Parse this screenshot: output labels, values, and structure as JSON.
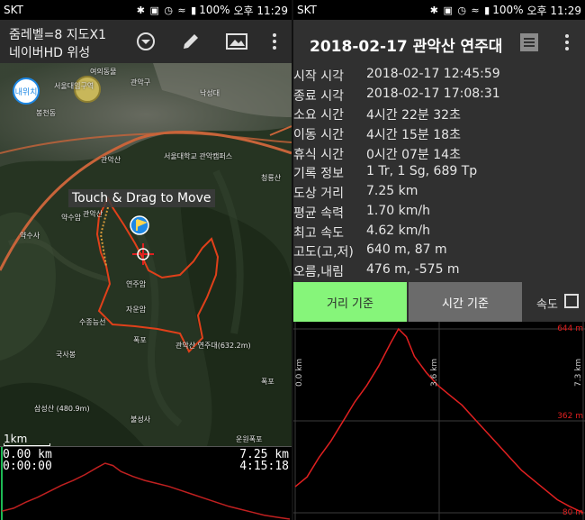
{
  "status_left": {
    "carrier": "SKT",
    "battery": "100%",
    "time": "오후 11:29"
  },
  "status_right": {
    "carrier": "SKT",
    "battery": "100%",
    "time": "오후 11:29"
  },
  "map_toolbar": {
    "zoom_line": "줌레벨=8 지도X1",
    "layer_line": "네이버HD 위성"
  },
  "map": {
    "locate_button": "내위치",
    "touch_hint": "Touch & Drag to Move",
    "scale": "1km",
    "labels": [
      {
        "text": "여의동물"
      },
      {
        "text": "서울대입구역"
      },
      {
        "text": "관악구"
      },
      {
        "text": "낙성대"
      },
      {
        "text": "봉천동"
      },
      {
        "text": "관악산"
      },
      {
        "text": "서울대학교 관악캠퍼스"
      },
      {
        "text": "청룡산"
      },
      {
        "text": "약수암"
      },
      {
        "text": "관악산"
      },
      {
        "text": "약수사"
      },
      {
        "text": "연주암"
      },
      {
        "text": "자운암"
      },
      {
        "text": "수종능선"
      },
      {
        "text": "폭포"
      },
      {
        "text": "관악산 연주대(632.2m)"
      },
      {
        "text": "국사봉"
      },
      {
        "text": "삼성산 (480.9m)"
      },
      {
        "text": "폭포"
      },
      {
        "text": "불성사"
      },
      {
        "text": "운원폭포"
      }
    ]
  },
  "left_profile": {
    "start_dist": "0.00 km",
    "start_time": "0:00:00",
    "end_dist": "7.25 km",
    "end_time": "4:15:18"
  },
  "track_title": "2018-02-17 관악산 연주대",
  "stats": [
    {
      "key": "시작 시각",
      "value": "2018-02-17 12:45:59"
    },
    {
      "key": "종료 시각",
      "value": "2018-02-17 17:08:31"
    },
    {
      "key": "소요 시간",
      "value": "4시간 22분 32초"
    },
    {
      "key": "이동 시간",
      "value": "4시간 15분 18초"
    },
    {
      "key": "휴식 시간",
      "value": "0시간 07분 14초"
    },
    {
      "key": "기록 정보",
      "value": "1 Tr, 1 Sg, 689 Tp"
    },
    {
      "key": "도상 거리",
      "value": "7.25 km"
    },
    {
      "key": "평균 속력",
      "value": "1.70 km/h"
    },
    {
      "key": "최고 속도",
      "value": "4.62 km/h"
    },
    {
      "key": "고도(고,저)",
      "value": "640 m, 87 m"
    },
    {
      "key": "오름,내림",
      "value": "476 m, -575 m"
    }
  ],
  "buttons": {
    "by_distance": "거리 기준",
    "by_time": "시간 기준",
    "speed_label": "속도"
  },
  "chart_data": {
    "type": "line",
    "x_ticks": [
      "0.0 km",
      "3.6 km",
      "7.3 km"
    ],
    "y_ticks": [
      "644 m",
      "362 m",
      "80 m"
    ],
    "x": [
      0.0,
      0.3,
      0.6,
      0.9,
      1.2,
      1.5,
      1.8,
      2.1,
      2.4,
      2.6,
      2.8,
      3.0,
      3.3,
      3.6,
      3.9,
      4.2,
      4.5,
      4.8,
      5.1,
      5.4,
      5.7,
      6.0,
      6.3,
      6.6,
      6.9,
      7.25
    ],
    "y": [
      160,
      190,
      250,
      300,
      360,
      420,
      470,
      530,
      600,
      644,
      620,
      560,
      510,
      470,
      440,
      410,
      370,
      330,
      290,
      250,
      210,
      180,
      150,
      120,
      100,
      80
    ],
    "xlim": [
      0,
      7.25
    ],
    "ylim": [
      80,
      644
    ],
    "colors": {
      "line": "#e02020",
      "grid": "#3c3c3c"
    }
  },
  "colors": {
    "accent_green": "#86f57a",
    "track": "#e0401a",
    "route": "#c8643a"
  }
}
